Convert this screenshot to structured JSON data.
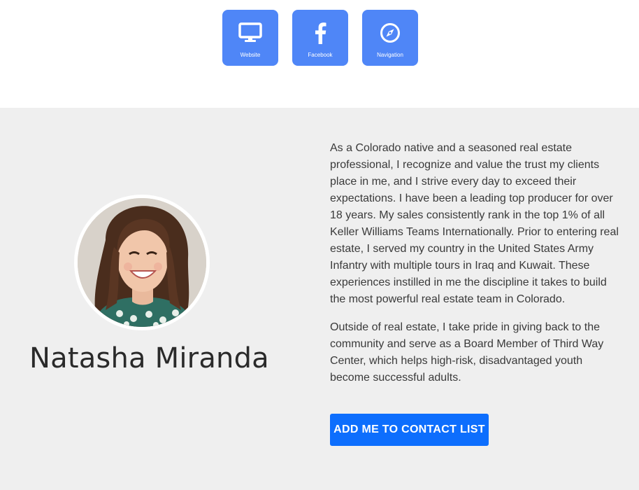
{
  "links": [
    {
      "label": "Website",
      "icon": "monitor-icon"
    },
    {
      "label": "Facebook",
      "icon": "facebook-icon"
    },
    {
      "label": "Navigation",
      "icon": "compass-icon"
    }
  ],
  "profile": {
    "name": "Natasha Miranda",
    "bio": [
      "As a Colorado native and a seasoned real estate professional, I recognize and value the trust my clients place in me, and I strive every day to exceed their expectations. I have been a leading top producer for over 18 years. My sales consistently rank in the top 1% of all Keller Williams Teams Internationally. Prior to entering real estate, I served my country in the United States Army Infantry with multiple tours in Iraq and Kuwait. These experiences instilled in me the discipline it takes to build the most powerful real estate team in Colorado.",
      "Outside of real estate, I take pride in giving back to the community and serve as a Board Member of Third Way Center, which helps high-risk, disadvantaged youth become successful adults."
    ],
    "contact_button": "ADD ME TO CONTACT LIST"
  },
  "colors": {
    "tile": "#4f86f7",
    "button": "#0d6efd",
    "section_bg": "#efefef"
  }
}
